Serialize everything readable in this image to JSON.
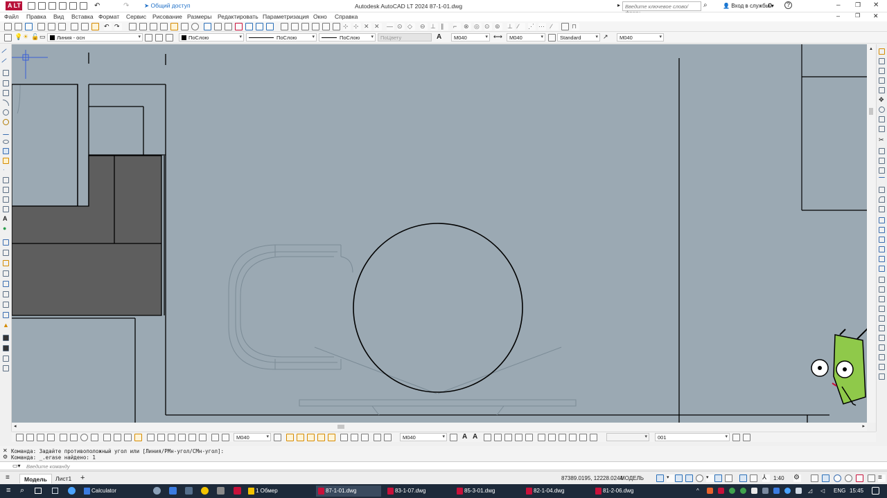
{
  "app": {
    "title": "Autodesk AutoCAD LT 2024    87-1-01.dwg",
    "logo": "A LT",
    "share": "Общий доступ",
    "search_placeholder": "Введите ключевое слово/фразу",
    "signin": "Вход в службы",
    "help": "?"
  },
  "menu": [
    "Файл",
    "Правка",
    "Вид",
    "Вставка",
    "Формат",
    "Сервис",
    "Рисование",
    "Размеры",
    "Редактировать",
    "Параметризация",
    "Окно",
    "Справка"
  ],
  "properties": {
    "layer": "Линия - осн",
    "color": "ПоСлою",
    "linetype": "ПоСлою",
    "lineweight": "ПоСлою",
    "plotstyle": "ПоЦвету",
    "textstyle": "M040",
    "dimstyle": "M040",
    "tablestyle": "Standard",
    "mleaderstyle": "M040"
  },
  "bottom_toolbar": {
    "dimstyle": "M040",
    "dimstyle2": "M040",
    "blank": "",
    "layer": "001"
  },
  "command": {
    "history": [
      "Команда: Задайте противоположный угол или [Линия/РМн-угол/СМн-угол]:",
      "Команда: _.erase найдено: 1"
    ],
    "placeholder": "Введите команду"
  },
  "status": {
    "tabs": [
      "Модель",
      "Лист1"
    ],
    "add_tab": "+",
    "coords": "87389.0195, 12228.0244",
    "space": "МОДЕЛЬ",
    "scale": "1:40"
  },
  "taskbar": {
    "apps": [
      {
        "label": "Calculator",
        "color": "#3b7be0"
      },
      {
        "label": "1 Обмер",
        "color": "#f2c200"
      },
      {
        "label": "87-1-01.dwg",
        "color": "#c8113a"
      },
      {
        "label": "83-1-07.dwg",
        "color": "#c8113a"
      },
      {
        "label": "85-3-01.dwg",
        "color": "#c8113a"
      },
      {
        "label": "82-1-04.dwg",
        "color": "#c8113a"
      },
      {
        "label": "81-2-06.dwg",
        "color": "#c8113a"
      }
    ],
    "lang": "ENG",
    "time": "15:45"
  },
  "colors": {
    "canvas": "#9ba9b3",
    "fill_dark": "#5e5e5e",
    "accent": "#c8113a",
    "taskbar": "#1d2a3a"
  }
}
